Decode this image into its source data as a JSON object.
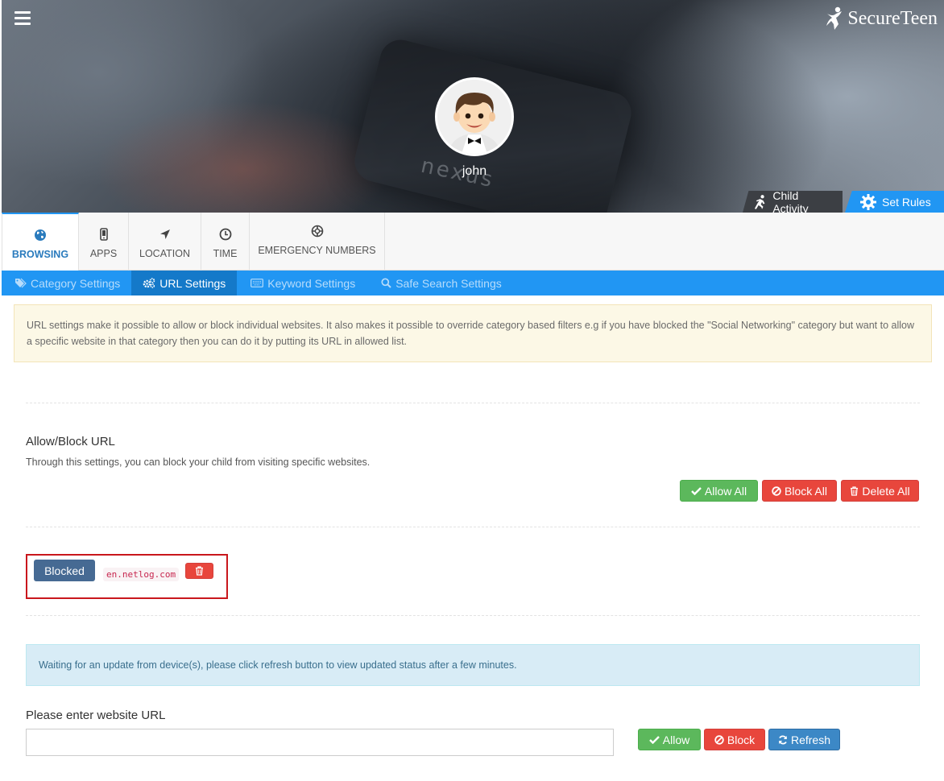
{
  "header": {
    "logo_text": "SecureTeen",
    "user_name": "john",
    "hero_tabs": [
      {
        "label": "Child Activity",
        "icon": "running-person-icon"
      },
      {
        "label": "Set Rules",
        "icon": "gear-icon"
      }
    ],
    "hero_watermark": "nexus"
  },
  "main_nav": {
    "items": [
      {
        "label": "BROWSING",
        "icon": "globe-icon",
        "active": true
      },
      {
        "label": "APPS",
        "icon": "mobile-icon",
        "active": false
      },
      {
        "label": "LOCATION",
        "icon": "location-arrow-icon",
        "active": false
      },
      {
        "label": "TIME",
        "icon": "clock-icon",
        "active": false
      },
      {
        "label": "EMERGENCY NUMBERS",
        "icon": "life-ring-icon",
        "active": false
      }
    ]
  },
  "sub_nav": {
    "items": [
      {
        "label": "Category Settings",
        "icon": "tags-icon",
        "active": false
      },
      {
        "label": "URL Settings",
        "icon": "cogs-icon",
        "active": true
      },
      {
        "label": "Keyword Settings",
        "icon": "keyboard-icon",
        "active": false
      },
      {
        "label": "Safe Search Settings",
        "icon": "search-icon",
        "active": false
      }
    ]
  },
  "info": {
    "text": "URL settings make it possible to allow or block individual websites. It also makes it possible to override category based filters e.g if you have blocked the \"Social Networking\" category but want to allow a specific website in that category then you can do it by putting its URL in allowed list."
  },
  "allow_block": {
    "title": "Allow/Block URL",
    "description": "Through this settings, you can block your child from visiting specific websites.",
    "allow_all_label": "Allow All",
    "block_all_label": "Block All",
    "delete_all_label": "Delete All"
  },
  "url_entries": [
    {
      "status": "Blocked",
      "url": "en.netlog.com"
    }
  ],
  "waiting": {
    "text": "Waiting for an update from device(s), please click refresh button to view updated status after a few minutes."
  },
  "url_form": {
    "label": "Please enter website URL",
    "value": "",
    "placeholder": "",
    "allow_label": "Allow",
    "block_label": "Block",
    "refresh_label": "Refresh"
  },
  "colors": {
    "primary": "#2196f3",
    "success": "#5cb85c",
    "danger": "#e8463c",
    "status_blocked": "#466a93",
    "highlight_frame": "#c9171c"
  }
}
